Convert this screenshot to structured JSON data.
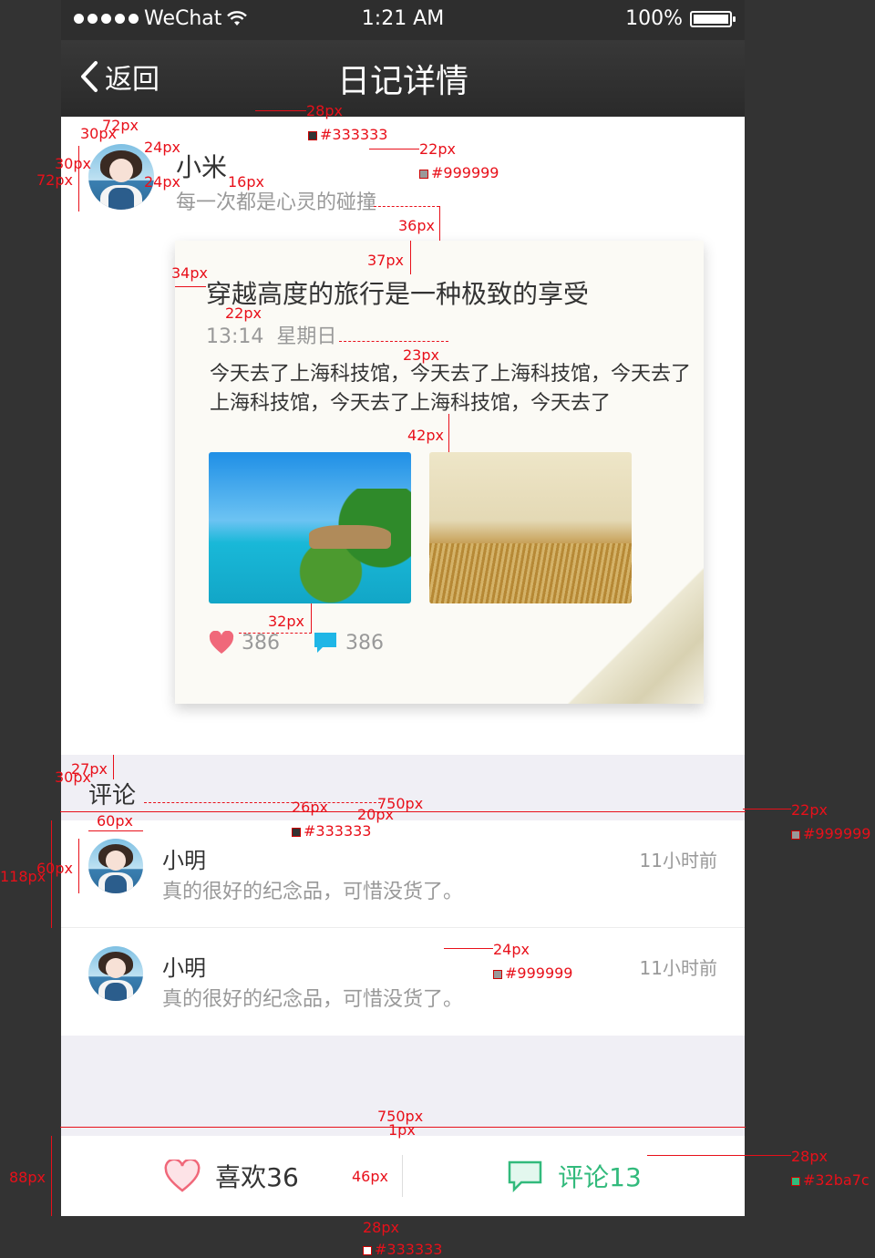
{
  "status_bar": {
    "carrier": "WeChat",
    "time": "1:21 AM",
    "battery": "100%"
  },
  "nav": {
    "back_label": "返回",
    "title": "日记详情"
  },
  "author": {
    "name": "小米",
    "signature": "每一次都是心灵的碰撞"
  },
  "diary": {
    "title": "穿越高度的旅行是一种极致的享受",
    "time": "13:14",
    "weekday": "星期日",
    "body": "今天去了上海科技馆，今天去了上海科技馆，今天去了上海科技馆，今天去了上海科技馆，今天去了",
    "likes": "386",
    "comments": "386"
  },
  "comments_section": {
    "heading": "评论",
    "items": [
      {
        "name": "小明",
        "text": "真的很好的纪念品，可惜没货了。",
        "time": "11小时前"
      },
      {
        "name": "小明",
        "text": "真的很好的纪念品，可惜没货了。",
        "time": "11小时前"
      }
    ]
  },
  "bottom_bar": {
    "like_label": "喜欢36",
    "comment_label": "评论13"
  },
  "colors": {
    "title_text": "#333333",
    "secondary_text": "#999999",
    "accent_green": "#32ba7c",
    "like_red": "#f0687a",
    "comment_blue": "#1fb6e6"
  },
  "annotations": {
    "a_28px": "28px",
    "a_333_1": "#333333",
    "a_22px_1": "22px",
    "a_999_1": "#999999",
    "a_72px_1": "72px",
    "a_30px_1": "30px",
    "a_24px_1": "24px",
    "a_30px_2": "30px",
    "a_72px_2": "72px",
    "a_24px_2": "24px",
    "a_16px": "16px",
    "a_36px": "36px",
    "a_37px": "37px",
    "a_34px": "34px",
    "a_22px_2": "22px",
    "a_23px": "23px",
    "a_42px": "42px",
    "a_32px": "32px",
    "a_27px": "27px",
    "a_30px_3": "30px",
    "a_26px": "26px",
    "a_333_2": "#333333",
    "a_20px": "20px",
    "a_750px_1": "750px",
    "a_22px_3": "22px",
    "a_999_2": "#999999",
    "a_60px_1": "60px",
    "a_60px_2": "60px",
    "a_118px": "118px",
    "a_24px_3": "24px",
    "a_999_3": "#999999",
    "a_750px_2": "750px",
    "a_1px": "1px",
    "a_88px": "88px",
    "a_46px": "46px",
    "a_28px_2": "28px",
    "a_32ba7c": "#32ba7c",
    "a_28px_3": "28px",
    "a_333_3": "#333333"
  }
}
